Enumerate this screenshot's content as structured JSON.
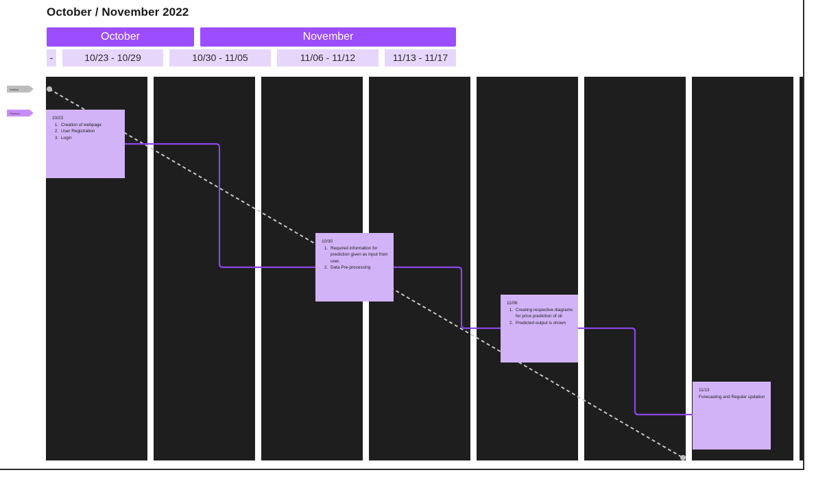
{
  "title": "October / November 2022",
  "months": [
    {
      "label": "October"
    },
    {
      "label": "November"
    }
  ],
  "weeks": [
    {
      "label": "-"
    },
    {
      "label": "10/23 - 10/29"
    },
    {
      "label": "10/30 - 11/05"
    },
    {
      "label": "11/06 - 11/12"
    },
    {
      "label": "11/13 - 11/17"
    }
  ],
  "legend": {
    "actual": {
      "label": "Vertical",
      "color": "#bdbdbd"
    },
    "planned": {
      "label": "Planned",
      "color": "#c98cf7"
    }
  },
  "milestones": [
    {
      "date": "10/23",
      "items": [
        "Creation of webpage",
        "User Registration",
        "Login"
      ],
      "text": ""
    },
    {
      "date": "10/30",
      "items": [
        "Required information for prediction given as input from user.",
        "Data Pre-processing"
      ],
      "text": ""
    },
    {
      "date": "11/06",
      "items": [
        "Creating respective diagrams for price prediction of oil",
        "Predicted output is shown"
      ],
      "text": ""
    },
    {
      "date": "11/13",
      "items": [],
      "text": "Forecasting and Regular updation"
    }
  ],
  "colors": {
    "accent": "#9b4dff",
    "week_fill": "#e7d6fc",
    "column": "#1e1e1e",
    "sticky": "#d3b3f7",
    "path": "#8b45e8",
    "dashed": "#c8c8c8"
  }
}
